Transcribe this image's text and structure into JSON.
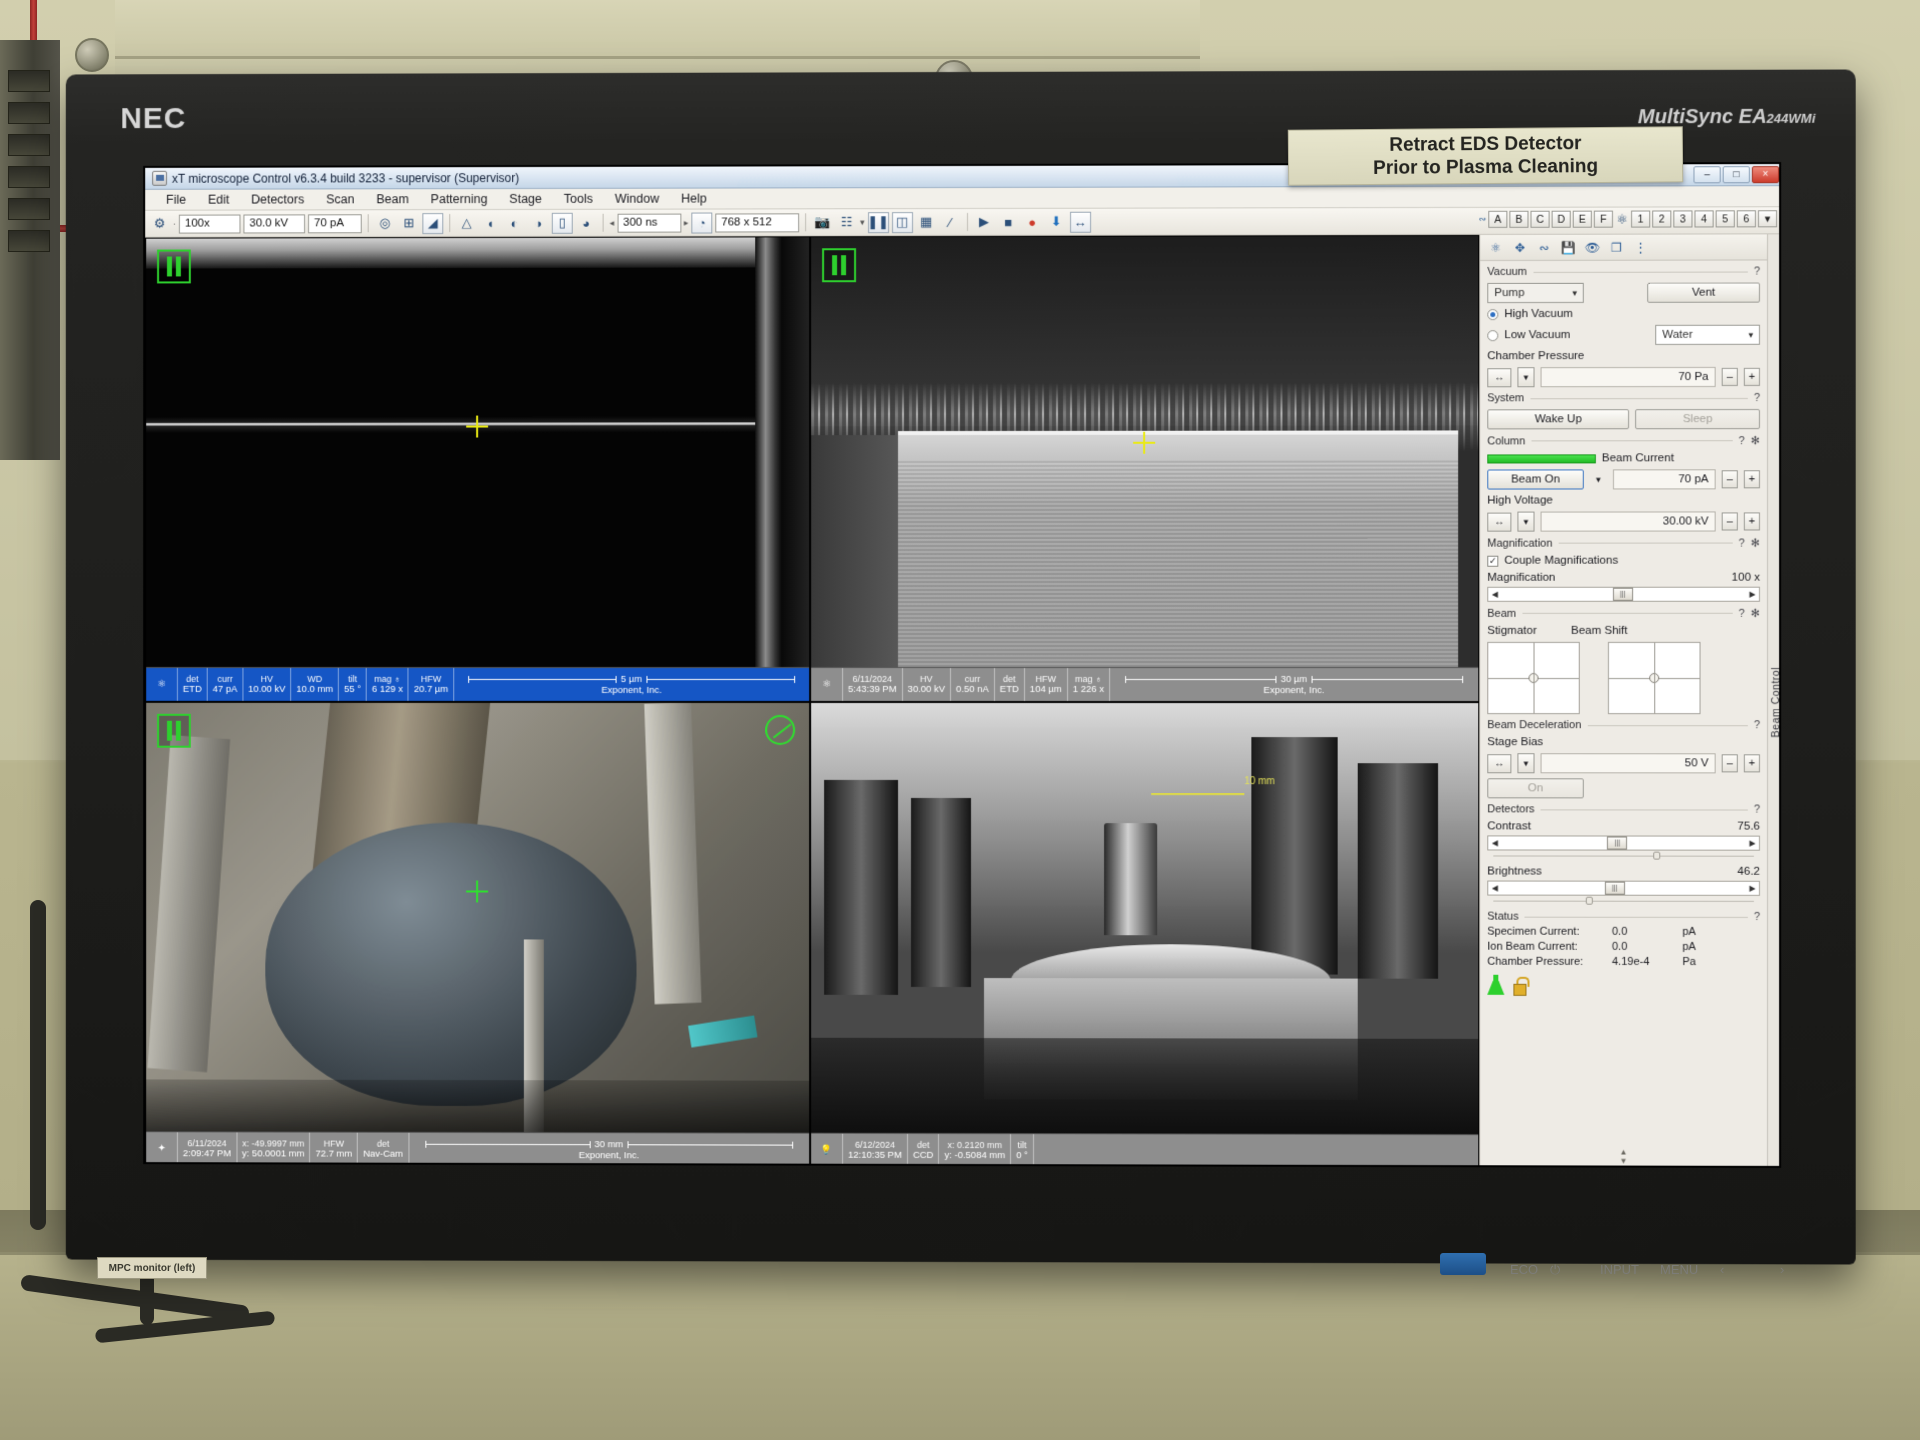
{
  "scene": {
    "sticker_line1": "Retract EDS Detector",
    "sticker_line2": "Prior to Plasma Cleaning",
    "monitor_brand": "NEC",
    "monitor_model": "MultiSync EA",
    "monitor_model_sub": "244WMi",
    "monitor_label": "MPC monitor (left)",
    "osd_input": "INPUT",
    "osd_menu": "MENU",
    "osd_prev": "‹",
    "osd_next": "›",
    "osd_power": "⏻",
    "osd_eco": "ECO"
  },
  "window": {
    "title": "xT microscope Control v6.3.4 build 3233 - supervisor (Supervisor)",
    "icon": "app-icon",
    "minimize": "–",
    "maximize": "□",
    "close": "×"
  },
  "menu": {
    "items": [
      "File",
      "Edit",
      "Detectors",
      "Scan",
      "Beam",
      "Patterning",
      "Stage",
      "Tools",
      "Window",
      "Help"
    ]
  },
  "toolbar": {
    "magnification": "100x",
    "high_voltage": "30.0 kV",
    "beam_current": "70 pA",
    "dwell_time": "300 ns",
    "resolution": "768 x 512",
    "icons": [
      "beam-blank-icon",
      "crosshair-target-icon",
      "center-point-icon",
      "reduced-area-icon",
      "column-icon",
      "contrast-brightness-icon",
      "auto-contrast-icon",
      "auto-brightness-icon",
      "video-scope-icon",
      "pie-contrast-icon"
    ],
    "quad_letters": [
      "A",
      "B",
      "C",
      "D",
      "E",
      "F"
    ],
    "quad_numbers": [
      "1",
      "2",
      "3",
      "4",
      "5",
      "6"
    ],
    "dropdown_arrow": "▾"
  },
  "toolbar2": {
    "icons": [
      "snapshot-icon",
      "pause-icon",
      "scan-preset-icon",
      "grid-icon",
      "link-z-icon",
      "play-icon",
      "stop-icon",
      "record-icon",
      "save-image-icon",
      "measure-icon"
    ]
  },
  "quadrants": [
    {
      "name": "quad-1-electron-sem",
      "paused": true,
      "databar_style": "blue",
      "logo": "fei-atom-icon",
      "cells": [
        {
          "key": "det",
          "value": "ETD"
        },
        {
          "key": "curr",
          "value": "47 pA"
        },
        {
          "key": "HV",
          "value": "10.00 kV"
        },
        {
          "key": "WD",
          "value": "10.0 mm"
        },
        {
          "key": "tilt",
          "value": "55 °"
        },
        {
          "key": "mag ♁",
          "value": "6 129 x"
        },
        {
          "key": "HFW",
          "value": "20.7 µm"
        }
      ],
      "scale": "5 µm",
      "owner": "Exponent, Inc."
    },
    {
      "name": "quad-2-ion-sem",
      "paused": true,
      "databar_style": "grey",
      "logo": "fei-atom-color-icon",
      "cells": [
        {
          "key": "6/11/2024",
          "value": "5:43:39 PM"
        },
        {
          "key": "HV",
          "value": "30.00 kV"
        },
        {
          "key": "curr",
          "value": "0.50 nA"
        },
        {
          "key": "det",
          "value": "ETD"
        },
        {
          "key": "HFW",
          "value": "104 µm"
        },
        {
          "key": "mag ♁",
          "value": "1 226 x"
        }
      ],
      "scale": "30 µm",
      "owner": "Exponent, Inc."
    },
    {
      "name": "quad-3-nav-cam",
      "paused": true,
      "databar_style": "grey",
      "logo": "compass-icon",
      "cells": [
        {
          "key": "6/11/2024",
          "value": "2:09:47 PM"
        },
        {
          "key": "x: -49.9997 mm",
          "value": "y: 50.0001 mm"
        },
        {
          "key": "HFW",
          "value": "72.7 mm"
        },
        {
          "key": "det",
          "value": "Nav-Cam"
        }
      ],
      "scale": "30 mm",
      "owner": "Exponent, Inc."
    },
    {
      "name": "quad-4-ccd",
      "paused": false,
      "databar_style": "grey",
      "logo": "lightbulb-icon",
      "cells": [
        {
          "key": "6/12/2024",
          "value": "12:10:35 PM"
        },
        {
          "key": "det",
          "value": "CCD"
        },
        {
          "key": "x: 0.2120 mm",
          "value": "y: -0.5084 mm"
        },
        {
          "key": "tilt",
          "value": "0 °"
        }
      ],
      "scale": "",
      "owner": "",
      "measure_label": "10 mm"
    }
  ],
  "sidebar": {
    "vertical_label": "Beam Control",
    "help_mark": "?",
    "settings_mark": "✻",
    "vacuum": {
      "title": "Vacuum",
      "pump_label": "Pump",
      "vent_label": "Vent",
      "high_vacuum_label": "High Vacuum",
      "low_vacuum_label": "Low Vacuum",
      "gas_value": "Water",
      "chamber_pressure_label": "Chamber Pressure",
      "chamber_pressure_value": "70 Pa",
      "minus": "–",
      "plus": "+"
    },
    "system": {
      "title": "System",
      "wake_up_label": "Wake Up",
      "sleep_label": "Sleep"
    },
    "column": {
      "title": "Column",
      "beam_on_label": "Beam On",
      "beam_current_label": "Beam Current",
      "beam_current_value": "70 pA",
      "high_voltage_label": "High Voltage",
      "high_voltage_value": "30.00 kV"
    },
    "magnification": {
      "title": "Magnification",
      "couple_label": "Couple Magnifications",
      "couple_checked": "✓",
      "mag_label": "Magnification",
      "mag_value": "100 x"
    },
    "beam": {
      "title": "Beam",
      "stigmator_label": "Stigmator",
      "beam_shift_label": "Beam Shift"
    },
    "beam_deceleration": {
      "title": "Beam Deceleration",
      "stage_bias_label": "Stage Bias",
      "stage_bias_value": "50 V",
      "on_label": "On"
    },
    "detectors": {
      "title": "Detectors",
      "contrast_label": "Contrast",
      "contrast_value": "75.6",
      "brightness_label": "Brightness",
      "brightness_value": "46.2"
    },
    "status": {
      "title": "Status",
      "rows": [
        {
          "name": "Specimen Current:",
          "value": "0.0",
          "unit": "pA"
        },
        {
          "name": "Ion Beam Current:",
          "value": "0.0",
          "unit": "pA"
        },
        {
          "name": "Chamber Pressure:",
          "value": "4.19e-4",
          "unit": "Pa"
        }
      ],
      "icons": [
        "vacuum-ok-icon",
        "unlocked-icon"
      ]
    }
  },
  "colors": {
    "databar_blue": "#1557c8",
    "databar_grey": "#8e8e8e",
    "beam_on_green": "#2bd02b",
    "crosshair_yellow": "#e9e90d",
    "accent_blue": "#2b6fc4"
  }
}
